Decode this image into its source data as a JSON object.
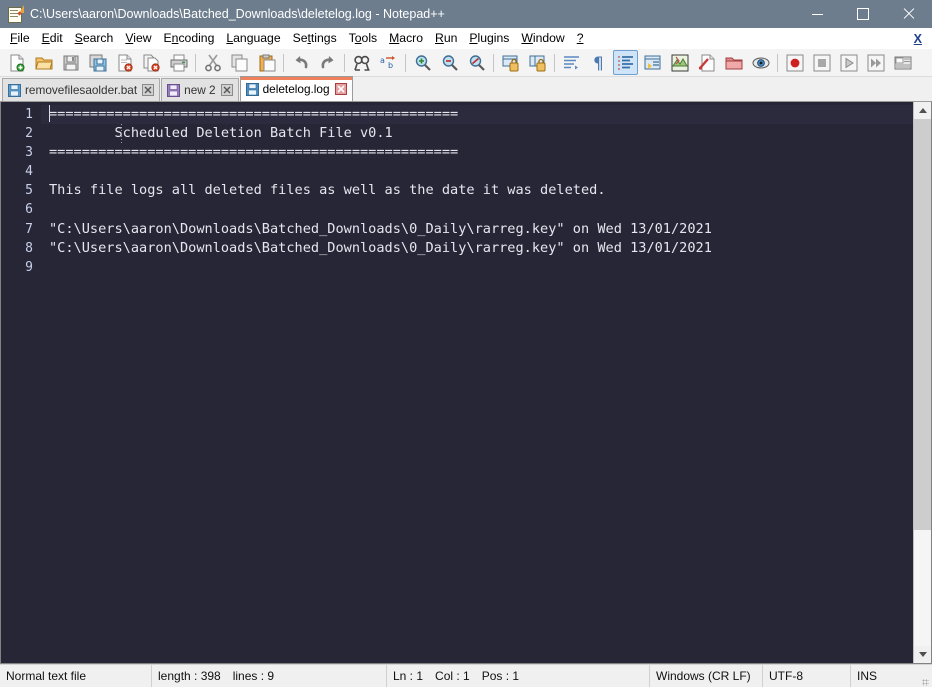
{
  "window": {
    "title": "C:\\Users\\aaron\\Downloads\\Batched_Downloads\\deletelog.log - Notepad++",
    "icon": "notepad-plus-plus-icon",
    "controls": {
      "minimize": "minimize-button",
      "maximize": "maximize-button",
      "close": "close-button"
    },
    "titlebar_color": "#6d7d8d"
  },
  "menu": {
    "items": [
      {
        "label": "File",
        "mnemonic": "F"
      },
      {
        "label": "Edit",
        "mnemonic": "E"
      },
      {
        "label": "Search",
        "mnemonic": "S"
      },
      {
        "label": "View",
        "mnemonic": "V"
      },
      {
        "label": "Encoding",
        "mnemonic": "n"
      },
      {
        "label": "Language",
        "mnemonic": "L"
      },
      {
        "label": "Settings",
        "mnemonic": "t"
      },
      {
        "label": "Tools",
        "mnemonic": "o"
      },
      {
        "label": "Macro",
        "mnemonic": "M"
      },
      {
        "label": "Run",
        "mnemonic": "R"
      },
      {
        "label": "Plugins",
        "mnemonic": "P"
      },
      {
        "label": "Window",
        "mnemonic": "W"
      },
      {
        "label": "?",
        "mnemonic": "?"
      }
    ],
    "close_document_label": "X"
  },
  "toolbar": {
    "groups": [
      [
        {
          "name": "new-file-icon",
          "title": "New"
        },
        {
          "name": "open-file-icon",
          "title": "Open"
        },
        {
          "name": "save-icon",
          "title": "Save"
        },
        {
          "name": "save-all-icon",
          "title": "Save All"
        },
        {
          "name": "close-file-icon",
          "title": "Close"
        },
        {
          "name": "close-all-icon",
          "title": "Close All"
        },
        {
          "name": "print-icon",
          "title": "Print"
        }
      ],
      [
        {
          "name": "cut-icon",
          "title": "Cut"
        },
        {
          "name": "copy-icon",
          "title": "Copy"
        },
        {
          "name": "paste-icon",
          "title": "Paste"
        }
      ],
      [
        {
          "name": "undo-icon",
          "title": "Undo"
        },
        {
          "name": "redo-icon",
          "title": "Redo"
        }
      ],
      [
        {
          "name": "find-icon",
          "title": "Find"
        },
        {
          "name": "replace-icon",
          "title": "Replace"
        }
      ],
      [
        {
          "name": "zoom-in-icon",
          "title": "Zoom In"
        },
        {
          "name": "zoom-out-icon",
          "title": "Zoom Out"
        },
        {
          "name": "zoom-restore-icon",
          "title": "Restore Default Zoom"
        }
      ],
      [
        {
          "name": "sync-vertical-scroll-icon",
          "title": "Synchronize Vertical Scrolling"
        },
        {
          "name": "sync-horizontal-scroll-icon",
          "title": "Synchronize Horizontal Scrolling"
        }
      ],
      [
        {
          "name": "word-wrap-icon",
          "title": "Word wrap"
        },
        {
          "name": "show-all-chars-icon",
          "title": "Show All Characters"
        },
        {
          "name": "indent-guide-icon",
          "title": "Show Indent Guide",
          "active": true
        },
        {
          "name": "udl-dialog-icon",
          "title": "User-Defined Language Dialog"
        },
        {
          "name": "document-map-icon",
          "title": "Document Map"
        },
        {
          "name": "function-list-icon",
          "title": "Function List"
        },
        {
          "name": "folder-workspace-icon",
          "title": "Folder as Workspace"
        },
        {
          "name": "monitoring-icon",
          "title": "Monitoring"
        }
      ],
      [
        {
          "name": "macro-record-icon",
          "title": "Start Recording"
        },
        {
          "name": "macro-stop-icon",
          "title": "Stop Recording"
        },
        {
          "name": "macro-play-icon",
          "title": "Playback"
        },
        {
          "name": "macro-run-multiple-icon",
          "title": "Run a Macro Multiple Times"
        },
        {
          "name": "macro-save-icon",
          "title": "Save Current Recorded Macro"
        }
      ]
    ]
  },
  "tabs": [
    {
      "label": "removefilesaolder.bat",
      "active": false,
      "icon": "saved-disk-icon",
      "icon_color": "#4f90c8",
      "close_icon": "tab-close-icon"
    },
    {
      "label": "new 2",
      "active": false,
      "icon": "unsaved-disk-icon",
      "icon_color": "#8a6fb0",
      "close_icon": "tab-close-icon"
    },
    {
      "label": "deletelog.log",
      "active": true,
      "icon": "saved-disk-icon",
      "icon_color": "#4f90c8",
      "close_icon": "tab-close-icon-active"
    }
  ],
  "editor": {
    "background": "#262636",
    "text_color": "#e6e6ef",
    "line_number_color": "#c8d0e8",
    "line_numbers": [
      "1",
      "2",
      "3",
      "4",
      "5",
      "6",
      "7",
      "8",
      "9"
    ],
    "lines": [
      "==================================================",
      "        Scheduled Deletion Batch File v0.1",
      "==================================================",
      "",
      "This file logs all deleted files as well as the date it was deleted.",
      "",
      "\"C:\\Users\\aaron\\Downloads\\Batched_Downloads\\0_Daily\\rarreg.key\" on Wed 13/01/2021",
      "\"C:\\Users\\aaron\\Downloads\\Batched_Downloads\\0_Daily\\rarreg.key\" on Wed 13/01/2021",
      ""
    ]
  },
  "scrollbar": {
    "up_arrow": "scroll-up-arrow-icon",
    "down_arrow": "scroll-down-arrow-icon",
    "thumb": "scroll-thumb"
  },
  "statusbar": {
    "file_type": "Normal text file",
    "length_label": "length : 398",
    "lines_label": "lines : 9",
    "ln": "Ln : 1",
    "col": "Col : 1",
    "pos": "Pos : 1",
    "eol": "Windows (CR LF)",
    "encoding": "UTF-8",
    "insert_mode": "INS"
  }
}
